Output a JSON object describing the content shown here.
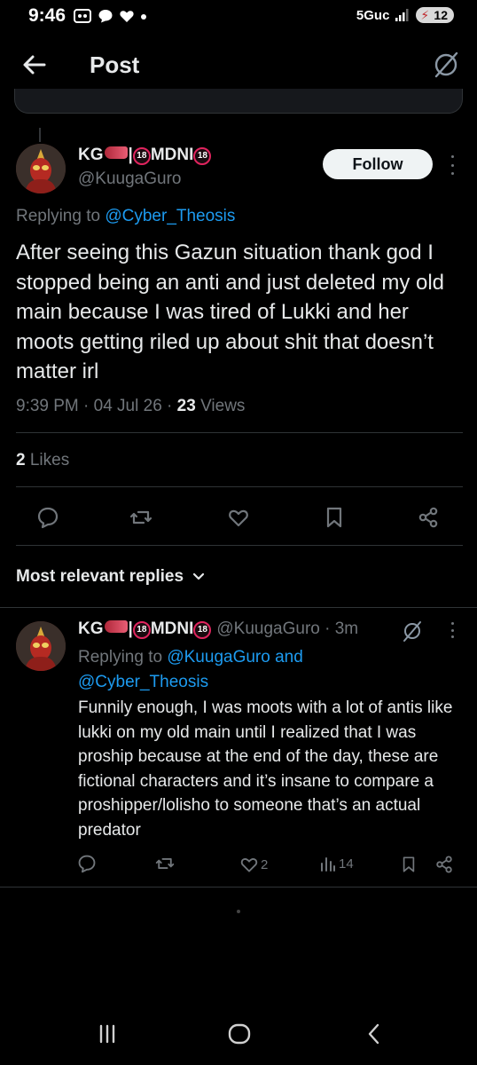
{
  "status_bar": {
    "time": "9:46",
    "network": "5Guc",
    "battery": "12"
  },
  "header": {
    "title": "Post"
  },
  "post": {
    "display_name_prefix": "KG",
    "display_name_mid": "|",
    "display_name_suffix": "MDNI",
    "badge_text": "18",
    "handle": "@KuugaGuro",
    "follow_label": "Follow",
    "replying_prefix": "Replying to ",
    "replying_to": "@Cyber_Theosis",
    "text": "After seeing this Gazun situation thank god I stopped being an anti and just deleted my old main because I was tired of Lukki and her moots getting riled up about shit that doesn’t matter irl",
    "time": "9:39 PM · 04 Jul 26 · ",
    "views_count": "23",
    "views_label": " Views",
    "likes_count": "2",
    "likes_label": " Likes"
  },
  "replies_section": {
    "sort_label": "Most relevant replies"
  },
  "reply": {
    "display_name_prefix": "KG",
    "display_name_mid": "|",
    "display_name_suffix": "MDNI",
    "badge_text": "18",
    "handle_time": "@KuugaGuro · 3m",
    "replying_prefix": "Replying to ",
    "replying_to_1": "@KuugaGuro and",
    "replying_to_2": "@Cyber_Theosis",
    "text": "Funnily enough, I was moots with a lot of antis like lukki on my old main until I realized that I was proship because at the end of the day, these are fictional characters and it’s insane to compare a proshipper/lolisho to someone that’s an actual predator",
    "like_count": "2",
    "view_count": "14"
  },
  "colors": {
    "background": "#000000",
    "text_primary": "#e7e9ea",
    "text_secondary": "#71767b",
    "accent_link": "#1d9bf0",
    "divider": "#2f3336"
  }
}
